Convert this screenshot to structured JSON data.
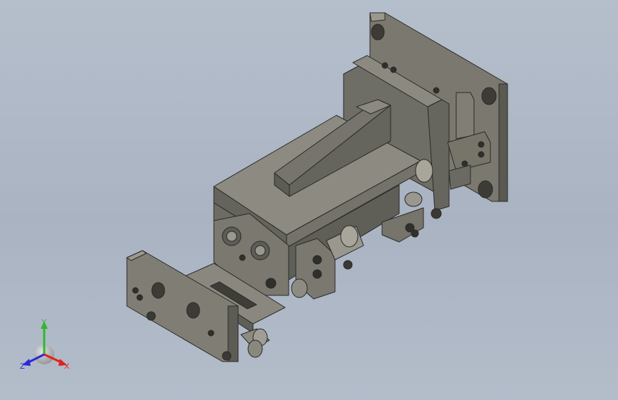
{
  "triad": {
    "x_label": "X",
    "y_label": "Y",
    "z_label": "Z",
    "x_color": "#e0201c",
    "y_color": "#2fb82f",
    "z_color": "#2a2ad6"
  },
  "colors": {
    "background": "#adb7c5",
    "part_light": "#8c8a80",
    "part_mid": "#77756c",
    "part_dark": "#55544d",
    "edge": "#2a2a28"
  }
}
